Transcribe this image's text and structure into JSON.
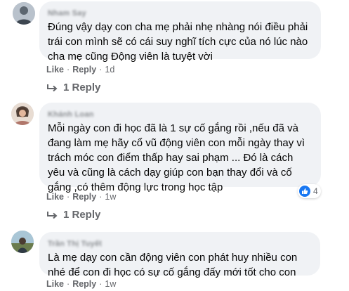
{
  "comments": [
    {
      "author": "Nham Say",
      "text_lines": [
        "Đúng vậy dạy con cha mẹ phải nhẹ nhàng nói điều phải",
        "trái con mình sẽ có cái suy nghĩ tích cực của nó lúc nào",
        "cha mẹ cũng Động viên là tuyệt vời"
      ],
      "like_label": "Like",
      "reply_label": "Reply",
      "separator": "·",
      "time": "1d",
      "replies_label": "1 Reply"
    },
    {
      "author": "Khánh Loan",
      "text_lines": [
        "Mỗi ngày con đi học đã là 1 sự cố gắng rồi ,nếu đã và",
        "đang làm mẹ hãy cổ vũ động viên con mỗi ngày thay vì",
        "trách móc con điểm thấp hay sai phạm ... Đó là cách",
        "yêu và cũng là cách dạy giúp con bạn thay đổi và cố",
        "gắng ,có thêm động lực trong học tập"
      ],
      "reaction_count": "4",
      "like_label": "Like",
      "reply_label": "Reply",
      "separator": "·",
      "time": "1w",
      "replies_label": "1 Reply"
    },
    {
      "author": "Trần Thị Tuyết",
      "text_lines": [
        "Là mẹ dạy con cần động viên con phát huy nhiều con",
        "nhé để con đi học có sự cố gắng đấy mới tốt cho con"
      ],
      "like_label": "Like",
      "reply_label": "Reply",
      "separator": "·",
      "time": "1w"
    }
  ],
  "colors": {
    "bubble": "#f0f2f5",
    "secondary_text": "#65676b",
    "like_blue": "#1877f2"
  },
  "icons": {
    "reply_arrow": "reply-arrow-icon",
    "reaction": "thumbs-up-icon"
  }
}
